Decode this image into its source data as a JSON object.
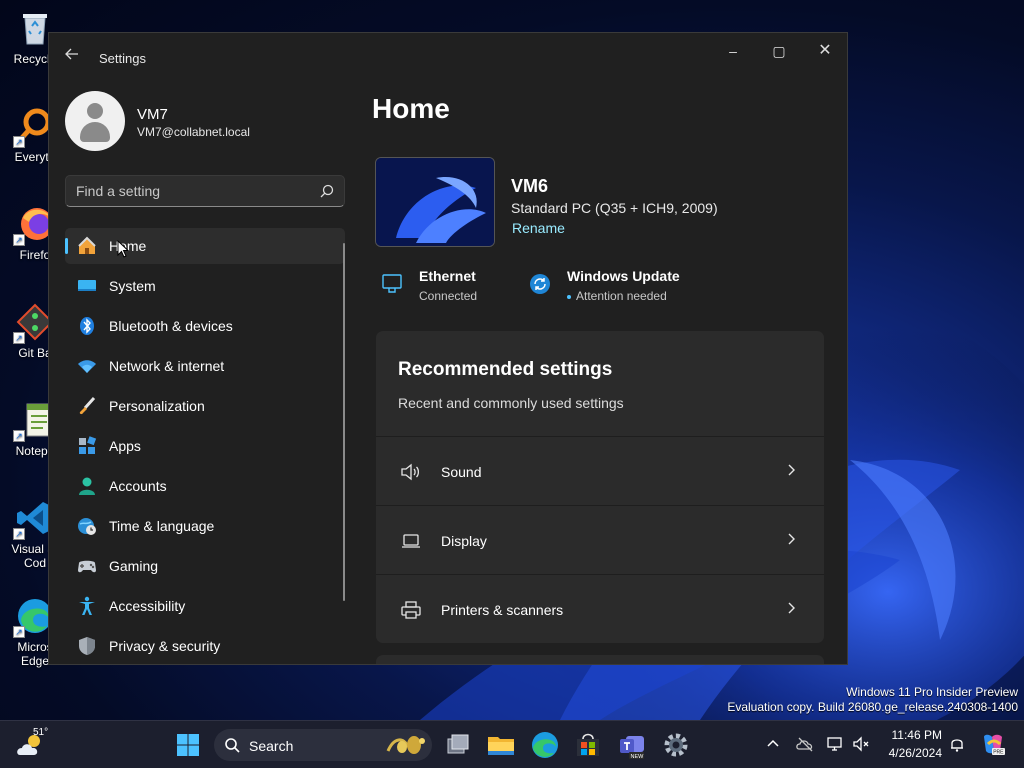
{
  "window": {
    "title": "Settings",
    "controls": {
      "minimize": "–",
      "maximize": "▢",
      "close": "✕"
    }
  },
  "profile": {
    "name": "VM7",
    "email": "VM7@collabnet.local"
  },
  "search": {
    "placeholder": "Find a setting",
    "value": ""
  },
  "nav": {
    "items": [
      {
        "label": "Home",
        "icon": "home-icon",
        "active": true
      },
      {
        "label": "System",
        "icon": "system-icon"
      },
      {
        "label": "Bluetooth & devices",
        "icon": "bluetooth-icon"
      },
      {
        "label": "Network & internet",
        "icon": "wifi-icon"
      },
      {
        "label": "Personalization",
        "icon": "brush-icon"
      },
      {
        "label": "Apps",
        "icon": "apps-icon"
      },
      {
        "label": "Accounts",
        "icon": "accounts-icon"
      },
      {
        "label": "Time & language",
        "icon": "globe-clock-icon"
      },
      {
        "label": "Gaming",
        "icon": "controller-icon"
      },
      {
        "label": "Accessibility",
        "icon": "accessibility-icon"
      },
      {
        "label": "Privacy & security",
        "icon": "shield-icon"
      }
    ]
  },
  "main": {
    "title": "Home",
    "device": {
      "name": "VM6",
      "model": "Standard PC (Q35 + ICH9, 2009)",
      "rename": "Rename"
    },
    "status": {
      "ethernet": {
        "title": "Ethernet",
        "sub": "Connected"
      },
      "update": {
        "title": "Windows Update",
        "sub": "Attention needed"
      }
    },
    "recommended": {
      "title": "Recommended settings",
      "subtitle": "Recent and commonly used settings",
      "rows": [
        {
          "label": "Sound",
          "icon": "speaker-icon"
        },
        {
          "label": "Display",
          "icon": "laptop-icon"
        },
        {
          "label": "Printers & scanners",
          "icon": "printer-icon"
        }
      ]
    }
  },
  "desktop": {
    "icons": [
      {
        "label": "Recycle",
        "icon": "recycle-bin-icon"
      },
      {
        "label": "Everyth",
        "icon": "everything-search-icon"
      },
      {
        "label": "Firefo",
        "icon": "firefox-icon"
      },
      {
        "label": "Git Ba",
        "icon": "git-bash-icon"
      },
      {
        "label": "Notepa",
        "icon": "notepad-icon"
      },
      {
        "label": "Visual St Cod",
        "icon": "vscode-icon"
      },
      {
        "label": "Micros Edge",
        "icon": "edge-icon"
      }
    ],
    "watermark": {
      "line1": "Windows 11 Pro Insider Preview",
      "line2": "Evaluation copy. Build 26080.ge_release.240308-1400"
    }
  },
  "taskbar": {
    "weather_temp": "51°",
    "search_label": "Search",
    "time": "11:46 PM",
    "date": "4/26/2024",
    "apps": [
      "task-view-icon",
      "file-explorer-icon",
      "edge-icon",
      "store-icon",
      "teams-icon",
      "settings-icon"
    ]
  },
  "colors": {
    "accent": "#4cc2ff",
    "link": "#99ebff",
    "window_bg": "#202020",
    "card_bg": "#2b2b2b"
  }
}
